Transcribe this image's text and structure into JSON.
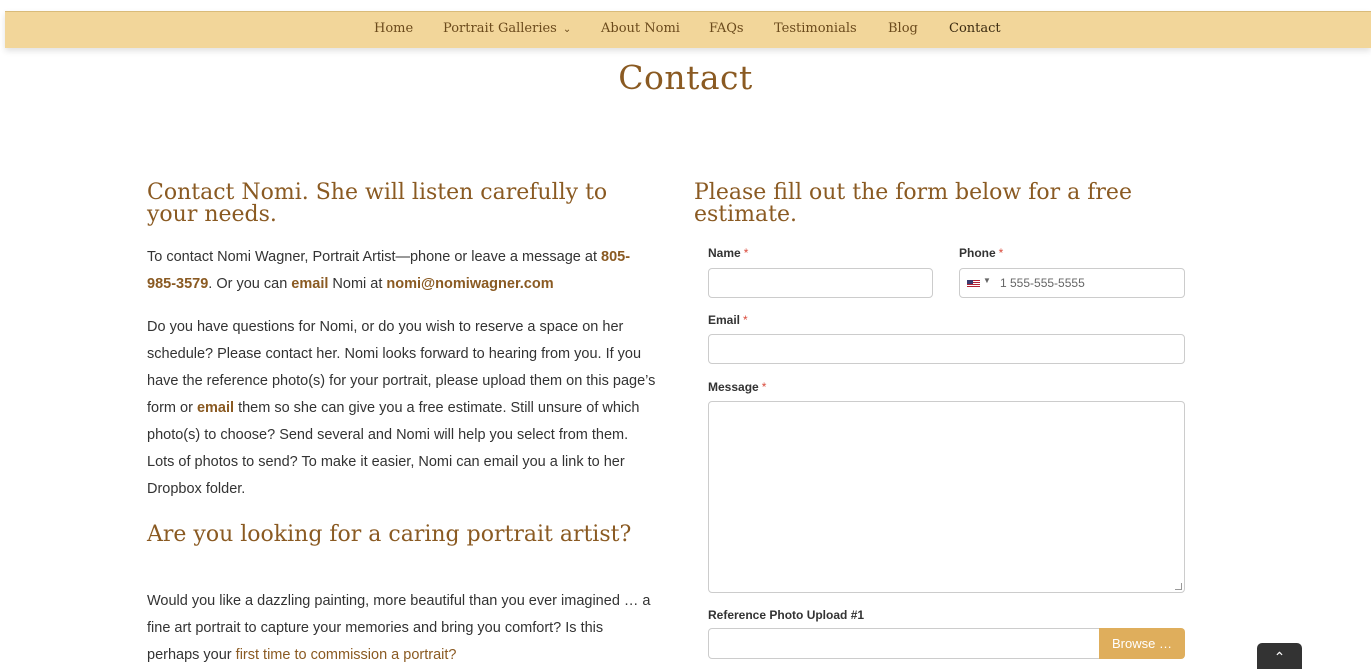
{
  "nav": {
    "items": [
      "Home",
      "Portrait Galleries",
      "About Nomi",
      "FAQs",
      "Testimonials",
      "Blog",
      "Contact"
    ],
    "dropdown_icon": "chevron-down-icon"
  },
  "page_title": "Contact",
  "left": {
    "heading1": "Contact Nomi. She will listen carefully to your needs.",
    "p1_part1": "To contact Nomi Wagner, Portrait Artist—phone or leave a message at",
    "p1_phone": "805-985-3579",
    "p1_part2": ". Or you can ",
    "p1_email_word": "email",
    "p1_part3": " Nomi at ",
    "p1_email": "nomi@nomiwagner.com",
    "p2_part1": "Do you have questions for Nomi, or do you wish to reserve a space on her schedule? Please contact her. Nomi looks forward to hearing from you. If you have the reference photo(s) for your portrait, please upload them on this page’s form or ",
    "p2_email_word": "email",
    "p2_part2": " them so she can give you a free estimate. Still unsure of which photo(s) to choose? Send several and Nomi will help you select from them. Lots of photos to send? To make it easier, Nomi can email you a link to her Dropbox folder.",
    "heading2": "Are you looking for a caring portrait artist?",
    "p3_part1": "Would you like a dazzling painting, more beautiful than you ever imagined … a fine art portrait to capture your memories and bring you comfort? Is this perhaps your ",
    "p3_link": "first time to commission a portrait?"
  },
  "form": {
    "heading": "Please fill out the form below for a free estimate.",
    "name_label": "Name",
    "phone_label": "Phone",
    "phone_placeholder": "1 555-555-5555",
    "email_label": "Email",
    "message_label": "Message",
    "required_mark": "*",
    "upload_label": "Reference Photo Upload #1",
    "browse_label": "Browse …"
  },
  "back_to_top_icon": "chevron-up-icon",
  "colors": {
    "nav_bg": "#f2d69a",
    "accent": "#8a5a22",
    "browse_bg": "#dfae5c",
    "required": "#d94b3c"
  }
}
